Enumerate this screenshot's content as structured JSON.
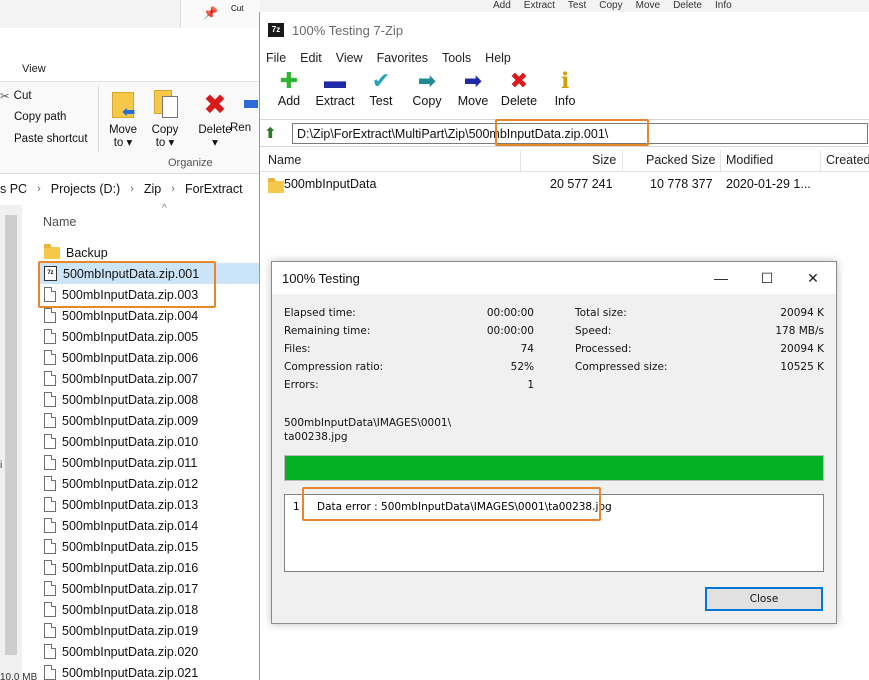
{
  "explorer": {
    "top_commands": [
      "Add",
      "Extract",
      "Test",
      "Copy",
      "Move",
      "Delete",
      "Info"
    ],
    "top_cut": "Cut",
    "tab_view": "View",
    "ribbon": {
      "cut": "Cut",
      "copy_path": "Copy path",
      "paste_shortcut": "Paste shortcut",
      "move_to": "Move\nto ▾",
      "copy_to": "Copy\nto ▾",
      "delete": "Delete\n▾",
      "rename": "Ren",
      "group_label": "Organize"
    },
    "breadcrumb": [
      "s PC",
      "Projects (D:)",
      "Zip",
      "ForExtract"
    ],
    "column_name": "Name",
    "files": [
      {
        "name": "Backup",
        "type": "folder"
      },
      {
        "name": "500mbInputData.zip.001",
        "type": "7z",
        "selected": true
      },
      {
        "name": "500mbInputData.zip.003",
        "type": "file"
      },
      {
        "name": "500mbInputData.zip.004",
        "type": "file"
      },
      {
        "name": "500mbInputData.zip.005",
        "type": "file"
      },
      {
        "name": "500mbInputData.zip.006",
        "type": "file"
      },
      {
        "name": "500mbInputData.zip.007",
        "type": "file"
      },
      {
        "name": "500mbInputData.zip.008",
        "type": "file"
      },
      {
        "name": "500mbInputData.zip.009",
        "type": "file"
      },
      {
        "name": "500mbInputData.zip.010",
        "type": "file"
      },
      {
        "name": "500mbInputData.zip.011",
        "type": "file"
      },
      {
        "name": "500mbInputData.zip.012",
        "type": "file"
      },
      {
        "name": "500mbInputData.zip.013",
        "type": "file"
      },
      {
        "name": "500mbInputData.zip.014",
        "type": "file"
      },
      {
        "name": "500mbInputData.zip.015",
        "type": "file"
      },
      {
        "name": "500mbInputData.zip.016",
        "type": "file"
      },
      {
        "name": "500mbInputData.zip.017",
        "type": "file"
      },
      {
        "name": "500mbInputData.zip.018",
        "type": "file"
      },
      {
        "name": "500mbInputData.zip.019",
        "type": "file"
      },
      {
        "name": "500mbInputData.zip.020",
        "type": "file"
      },
      {
        "name": "500mbInputData.zip.021",
        "type": "file"
      }
    ],
    "status_left": "10.0 MB",
    "left_mark": "i"
  },
  "sevenzip": {
    "title": "100% Testing 7-Zip",
    "logo": "7z",
    "menu": [
      "File",
      "Edit",
      "View",
      "Favorites",
      "Tools",
      "Help"
    ],
    "toolbar": [
      {
        "label": "Add",
        "icon": "plus-icon",
        "glyph": "✚",
        "color": "#2fb52f"
      },
      {
        "label": "Extract",
        "icon": "minus-icon",
        "glyph": "▬",
        "color": "#1f2aa8"
      },
      {
        "label": "Test",
        "icon": "check-icon",
        "glyph": "✔",
        "color": "#23a7b7"
      },
      {
        "label": "Copy",
        "icon": "double-arrow-icon",
        "glyph": "➡",
        "color": "#1e8a95"
      },
      {
        "label": "Move",
        "icon": "arrow-right-icon",
        "glyph": "➡",
        "color": "#1f2aa8"
      },
      {
        "label": "Delete",
        "icon": "delete-x-icon",
        "glyph": "✖",
        "color": "#d81a1a"
      },
      {
        "label": "Info",
        "icon": "info-icon",
        "glyph": "ℹ",
        "color": "#d4a000"
      }
    ],
    "address_prefix": "D:\\Zip\\ForExtract\\MultiPart\\Zip\\",
    "address_archive": "500mbInputData.zip.001\\",
    "columns": {
      "name": "Name",
      "size": "Size",
      "packed": "Packed Size",
      "modified": "Modified",
      "created": "Created"
    },
    "row": {
      "name": "500mbInputData",
      "size": "20 577 241",
      "packed": "10 778 377",
      "modified": "2020-01-29 1..."
    }
  },
  "dialog": {
    "title": "100% Testing",
    "left_stats": [
      {
        "label": "Elapsed time:",
        "value": "00:00:00"
      },
      {
        "label": "Remaining time:",
        "value": "00:00:00"
      },
      {
        "label": "Files:",
        "value": "74"
      },
      {
        "label": "Compression ratio:",
        "value": "52%"
      },
      {
        "label": "Errors:",
        "value": "1"
      }
    ],
    "right_stats": [
      {
        "label": "Total size:",
        "value": "20094 K"
      },
      {
        "label": "Speed:",
        "value": "178 MB/s"
      },
      {
        "label": "Processed:",
        "value": "20094 K"
      },
      {
        "label": "Compressed size:",
        "value": "10525 K"
      }
    ],
    "current_path_line1": "500mbInputData\\IMAGES\\0001\\",
    "current_path_line2": "ta00238.jpg",
    "progress": 1.0,
    "progress_color": "#06b025",
    "log": [
      {
        "num": "1",
        "msg": "Data error : 500mbInputData\\IMAGES\\0001\\ta00238.jpg"
      }
    ],
    "close_label": "Close",
    "minimize": "—",
    "maximize": "☐",
    "close_x": "✕"
  },
  "highlight_color": "#e8862a"
}
